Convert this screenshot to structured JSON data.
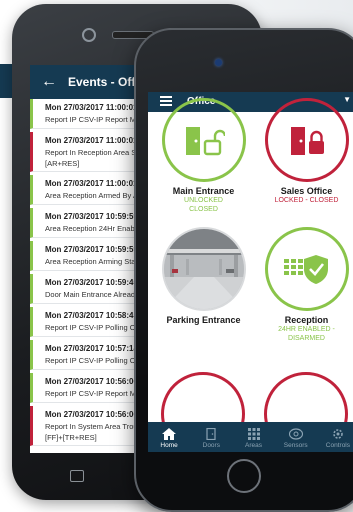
{
  "events_screen": {
    "title": "Events - Office",
    "back_icon": "back-arrow-icon",
    "events": [
      {
        "date": "Mon 27/03/2017 11:00:01",
        "desc": "Report IP CSV-IP Report Mes",
        "extra": "",
        "status": "ok"
      },
      {
        "date": "Mon 27/03/2017 11:00:01",
        "desc": "Report In Reception Area SY",
        "extra": "[AR+RES]",
        "status": "alarm"
      },
      {
        "date": "Mon 27/03/2017 11:00:01",
        "desc": "Area Reception Armed By Ac",
        "extra": "",
        "status": "ok"
      },
      {
        "date": "Mon 27/03/2017 10:59:59",
        "desc": "Area Reception 24Hr Enabled",
        "extra": "",
        "status": "ok"
      },
      {
        "date": "Mon 27/03/2017 10:59:59",
        "desc": "Area Reception Arming Starte",
        "extra": "",
        "status": "ok"
      },
      {
        "date": "Mon 27/03/2017 10:59:40",
        "desc": "Door Main Entrance Already I",
        "extra": "",
        "status": "ok"
      },
      {
        "date": "Mon 27/03/2017 10:58:45",
        "desc": "Report IP CSV-IP Polling Ok",
        "extra": "",
        "status": "ok"
      },
      {
        "date": "Mon 27/03/2017 10:57:14",
        "desc": "Report IP CSV-IP Polling Ok",
        "extra": "",
        "status": "ok"
      },
      {
        "date": "Mon 27/03/2017 10:56:06",
        "desc": "Report IP CSV-IP Report Mes",
        "extra": "",
        "status": "ok"
      },
      {
        "date": "Mon 27/03/2017 10:56:06",
        "desc": "Report In System Area Troub",
        "extra": "[FF]+[TR+RES]",
        "status": "alarm"
      }
    ]
  },
  "office_screen": {
    "title": "Office",
    "menu_icon": "hamburger-menu-icon",
    "dropdown_icon": "caret-down-icon",
    "tiles": [
      {
        "name": "Main Entrance",
        "status_lines": [
          "UNLOCKED",
          "CLOSED"
        ],
        "color": "#8ac44a",
        "icon": "door-unlocked-icon"
      },
      {
        "name": "Sales Office",
        "status_lines": [
          "LOCKED - CLOSED"
        ],
        "color": "#c0223b",
        "icon": "door-locked-icon"
      },
      {
        "name": "Parking Entrance",
        "status_lines": [],
        "color": "#d8dadc",
        "icon": "parking-garage-photo"
      },
      {
        "name": "Reception",
        "status_lines": [
          "24HR ENABLED -",
          "DISARMED"
        ],
        "color": "#8ac44a",
        "icon": "keypad-shield-icon"
      }
    ],
    "tabs": [
      {
        "label": "Home",
        "icon": "home-icon",
        "active": true
      },
      {
        "label": "Doors",
        "icon": "door-icon",
        "active": false
      },
      {
        "label": "Areas",
        "icon": "areas-grid-icon",
        "active": false
      },
      {
        "label": "Sensors",
        "icon": "sensor-icon",
        "active": false
      },
      {
        "label": "Controls",
        "icon": "controls-gear-icon",
        "active": false
      }
    ]
  },
  "colors": {
    "header": "#153a52",
    "ok": "#8ac44a",
    "alarm": "#c0223b"
  }
}
